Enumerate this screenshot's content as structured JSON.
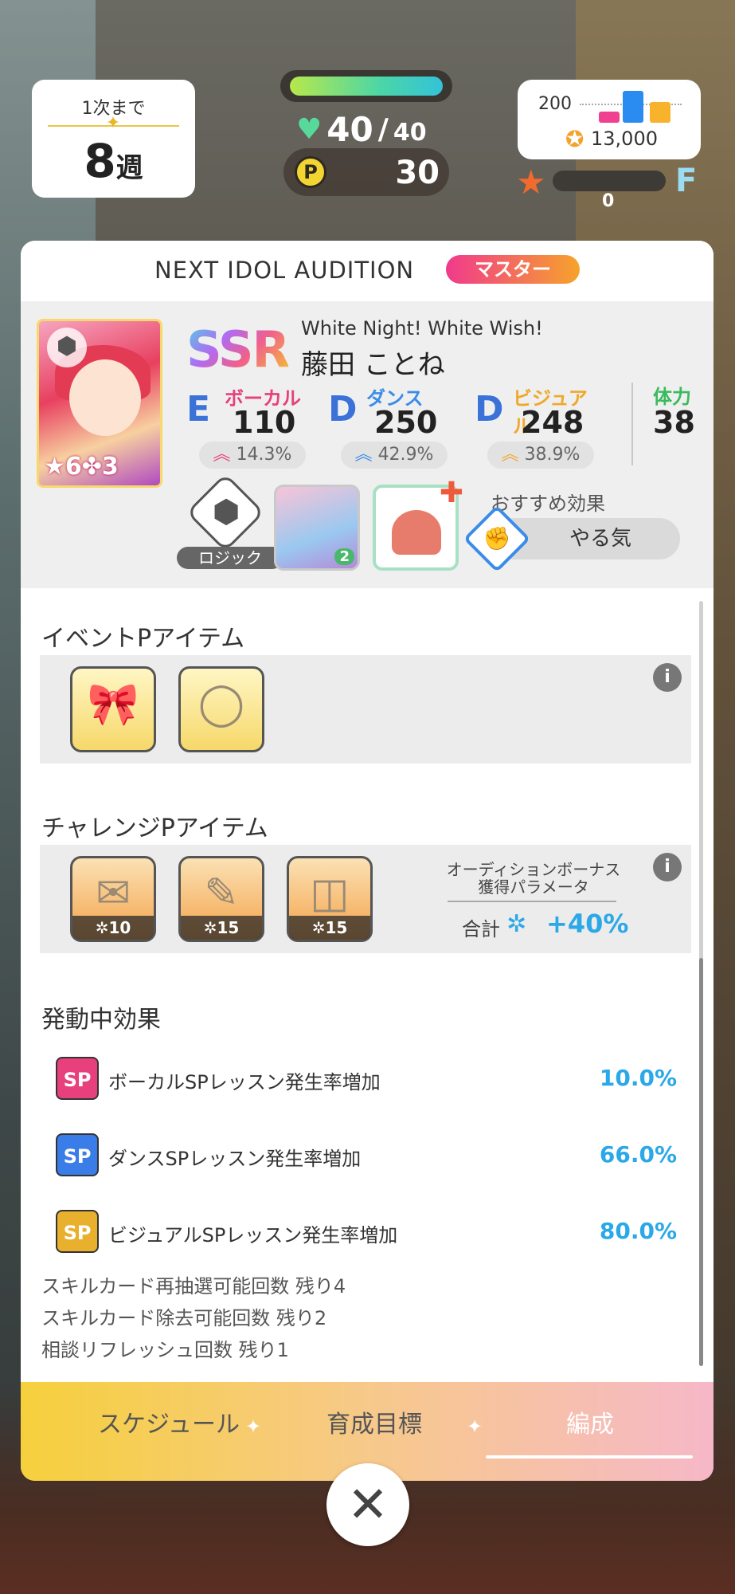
{
  "hud": {
    "week_until": "1次まで",
    "week_number": "8",
    "week_unit": "週",
    "hp_current": "40",
    "hp_slash": "/",
    "hp_max": "40",
    "hp_fill": 1.0,
    "p_label": "P",
    "p_value": "30",
    "fan_count_200": "200",
    "fan_total": "13,000",
    "rank_letter": "F",
    "rank_value": "0"
  },
  "card": {
    "title": "NEXT IDOL AUDITION",
    "difficulty": "マスター",
    "idol": {
      "rarity": "SSR",
      "subtitle": "White Night! White Wish!",
      "name": "藤田 ことね",
      "star_text": "6",
      "star_text2": "3",
      "stats": [
        {
          "rank": "E",
          "label": "ボーカル",
          "value": "110",
          "bonus": "14.3%",
          "color": "#e8407c"
        },
        {
          "rank": "D",
          "label": "ダンス",
          "value": "250",
          "bonus": "42.9%",
          "color": "#3a8ce8"
        },
        {
          "rank": "D",
          "label": "ビジュアル",
          "value": "248",
          "bonus": "38.9%",
          "color": "#f0a82c"
        }
      ],
      "stamina_label": "体力",
      "stamina_value": "38",
      "logic_label": "ロジック",
      "support_badge": "2",
      "recommend_label": "おすすめ効果",
      "recommend_value": "やる気"
    },
    "event_items_title": "イベントPアイテム",
    "challenge_items_title": "チャレンジPアイテム",
    "challenge_costs": [
      "10",
      "15",
      "15"
    ],
    "bonus_title_1": "オーディションボーナス",
    "bonus_title_2": "獲得パラメータ",
    "bonus_total_label": "合計",
    "bonus_total_value": "+40%",
    "effects_title": "発動中効果",
    "effects": [
      {
        "badge": "SP",
        "name": "ボーカルSPレッスン発生率増加",
        "value": "10.0%",
        "color": "#e8407c"
      },
      {
        "badge": "SP",
        "name": "ダンスSPレッスン発生率増加",
        "value": "66.0%",
        "color": "#3a7ce8"
      },
      {
        "badge": "SP",
        "name": "ビジュアルSPレッスン発生率増加",
        "value": "80.0%",
        "color": "#e8b02c"
      }
    ],
    "remains": [
      "スキルカード再抽選可能回数 残り4",
      "スキルカード除去可能回数 残り2",
      "相談リフレッシュ回数 残り1"
    ]
  },
  "tabs": {
    "schedule": "スケジュール",
    "goal": "育成目標",
    "formation": "編成"
  }
}
